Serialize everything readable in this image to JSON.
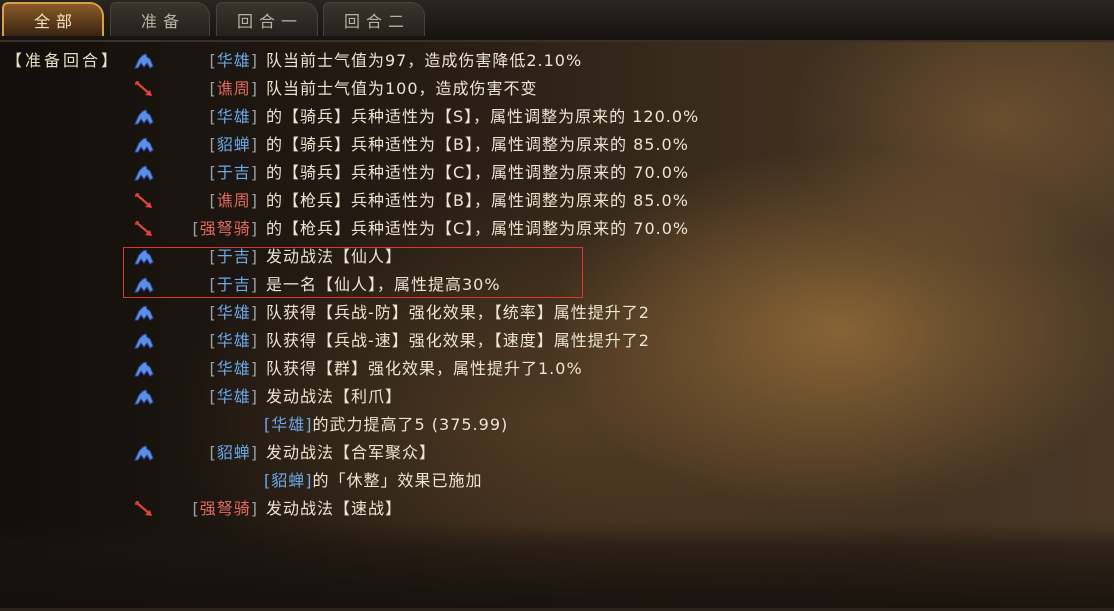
{
  "tabs": [
    {
      "label": "全部",
      "active": true
    },
    {
      "label": "准备",
      "active": false
    },
    {
      "label": "回合一",
      "active": false
    },
    {
      "label": "回合二",
      "active": false
    }
  ],
  "section_tag": "【准备回合】",
  "colors": {
    "ally": "#6aa8e8",
    "enemy": "#e06a60",
    "text": "#ece4d2",
    "highlight": "#d8382e",
    "tab_active": "#d9a04a"
  },
  "icons": {
    "ally": "blue-horse-icon",
    "enemy": "red-arrow-icon"
  },
  "log": [
    {
      "side": "ally",
      "name": "华雄",
      "text": "队当前士气值为97，造成伤害降低2.10%"
    },
    {
      "side": "enemy",
      "name": "谯周",
      "text": "队当前士气值为100，造成伤害不变"
    },
    {
      "side": "ally",
      "name": "华雄",
      "text": "的【骑兵】兵种适性为【S】，属性调整为原来的 120.0%"
    },
    {
      "side": "ally",
      "name": "貂蝉",
      "text": "的【骑兵】兵种适性为【B】，属性调整为原来的 85.0%"
    },
    {
      "side": "ally",
      "name": "于吉",
      "text": "的【骑兵】兵种适性为【C】，属性调整为原来的 70.0%"
    },
    {
      "side": "enemy",
      "name": "谯周",
      "text": "的【枪兵】兵种适性为【B】，属性调整为原来的 85.0%"
    },
    {
      "side": "enemy",
      "name": "强弩骑",
      "text": "的【枪兵】兵种适性为【C】，属性调整为原来的 70.0%"
    },
    {
      "side": "ally",
      "name": "于吉",
      "text": "发动战法【仙人】"
    },
    {
      "side": "ally",
      "name": "于吉",
      "text": "是一名【仙人】，属性提高30%"
    },
    {
      "side": "ally",
      "name": "华雄",
      "text": "队获得【兵战-防】强化效果，【统率】属性提升了2"
    },
    {
      "side": "ally",
      "name": "华雄",
      "text": "队获得【兵战-速】强化效果，【速度】属性提升了2"
    },
    {
      "side": "ally",
      "name": "华雄",
      "text": "队获得【群】强化效果，属性提升了1.0%"
    },
    {
      "side": "ally",
      "name": "华雄",
      "text": "发动战法【利爪】"
    },
    {
      "sub": true,
      "side": "ally",
      "name": "华雄",
      "text": "的武力提高了5 (375.99)"
    },
    {
      "side": "ally",
      "name": "貂蝉",
      "text": "发动战法【合军聚众】"
    },
    {
      "sub": true,
      "side": "ally",
      "name": "貂蝉",
      "text": "的「休整」效果已施加"
    },
    {
      "side": "enemy",
      "name": "强弩骑",
      "text": "发动战法【速战】"
    }
  ]
}
